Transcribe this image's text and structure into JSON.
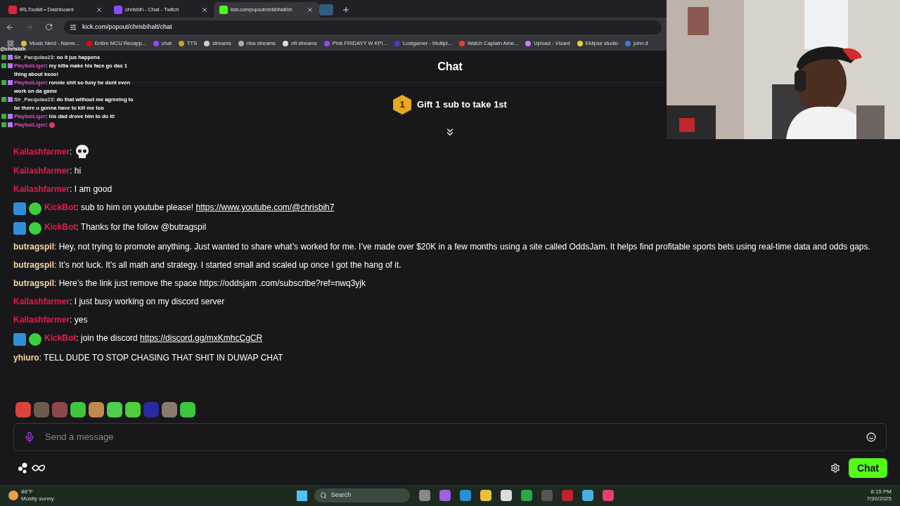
{
  "tabs": [
    {
      "title": "IRLToolkit • Dashboard",
      "selected": false,
      "color": "#e0243a"
    },
    {
      "title": "chrisbih - Chat - Twitch",
      "selected": false,
      "color": "#9147ff"
    },
    {
      "title": "kick.com/popout/chrisbihalt/ch",
      "selected": true,
      "color": "#53fc18"
    }
  ],
  "address": "kick.com/popout/chrisbihalt/chat",
  "bookmarks": [
    {
      "label": "Music Nerd - Name...",
      "color": "#e8b93a"
    },
    {
      "label": "Entire MCU Recapp...",
      "color": "#ff0000"
    },
    {
      "label": "chat",
      "color": "#9147ff"
    },
    {
      "label": "TTS",
      "color": "#c9a227"
    },
    {
      "label": "streams",
      "color": "#cccccc"
    },
    {
      "label": "nba streams",
      "color": "#aaaaaa"
    },
    {
      "label": "nfl streams",
      "color": "#dddddd"
    },
    {
      "label": "Pink FRIDAYY W KP!...",
      "color": "#9147ff"
    },
    {
      "label": "Lostgamer - Multipl...",
      "color": "#4b3ccf"
    },
    {
      "label": "Watch Captain Ame...",
      "color": "#e8402a"
    },
    {
      "label": "Upload - Vizard",
      "color": "#c77dff"
    },
    {
      "label": "Eklipse studio",
      "color": "#e8d23a"
    },
    {
      "label": "john d",
      "color": "#3a7bd5"
    }
  ],
  "overlay": {
    "channel": "@chrisbih",
    "lines": [
      {
        "name": "Sir_Pacquiao23",
        "color": "#cfcfcf",
        "text": ": no it jus happens",
        "kind": "text"
      },
      {
        "name": "PlayboiLiger",
        "color": "#e04cc4",
        "text": ": my killa make his face go das 1 thing about ksoo!",
        "kind": "text"
      },
      {
        "name": "PlayboiLiger",
        "color": "#e04cc4",
        "text": ": ronnie shit so funy he dont even work on da game",
        "kind": "text"
      },
      {
        "name": "Sir_Pacquiao23",
        "color": "#cfcfcf",
        "text": ": do that without me agreeing to be there u gonna have to kill me too",
        "kind": "text"
      },
      {
        "name": "PlayboiLiger",
        "color": "#e04cc4",
        "text": ": his dad drove him to do it!",
        "kind": "text"
      },
      {
        "name": "PlayboiLiger",
        "color": "#e04cc4",
        "text": ":",
        "kind": "emote"
      }
    ]
  },
  "chat": {
    "title": "Chat",
    "gift_rank": "1",
    "gift_text": "Gift 1 sub to take 1st",
    "messages": [
      {
        "kind": "emote",
        "name": "Kailashfarmer",
        "color": "#e01e4c",
        "text": ":"
      },
      {
        "kind": "user",
        "name": "Kailashfarmer",
        "color": "#e01e4c",
        "text": ": hi"
      },
      {
        "kind": "user",
        "name": "Kailashfarmer",
        "color": "#e01e4c",
        "text": ": I am good"
      },
      {
        "kind": "bot",
        "name": "KickBot",
        "color": "#e01e4c",
        "text": ": sub to him on youtube please!",
        "link": "https://www.youtube.com/@chrisbih7"
      },
      {
        "kind": "bot",
        "name": "KickBot",
        "color": "#e01e4c",
        "text": ": Thanks for the follow @butragspil"
      },
      {
        "kind": "user",
        "name": "butragspil",
        "color": "#f5d7a0",
        "text": ": Hey, not trying to promote anything. Just wanted to share what’s worked for me. I’ve made over $20K in a few months using a site called OddsJam. It helps find profitable sports bets using real-time data and odds gaps."
      },
      {
        "kind": "user",
        "name": "butragspil",
        "color": "#f5d7a0",
        "text": ": It’s not luck. It’s all math and strategy. I started small and scaled up once I got the hang of it."
      },
      {
        "kind": "user",
        "name": "butragspil",
        "color": "#f5d7a0",
        "text": ": Here’s the link just remove the space https://oddsjam .com/subscribe?ref=nwq3yjk"
      },
      {
        "kind": "user",
        "name": "Kailashfarmer",
        "color": "#e01e4c",
        "text": ": I just busy working on my discord server"
      },
      {
        "kind": "user",
        "name": "Kailashfarmer",
        "color": "#e01e4c",
        "text": ": yes"
      },
      {
        "kind": "bot",
        "name": "KickBot",
        "color": "#e01e4c",
        "text": ": join the discord",
        "link": "https://discord.gg/mxKmhcCgCR"
      },
      {
        "kind": "user",
        "name": "yhiuro",
        "color": "#f5d7a0",
        "text": ": TELL DUDE TO STOP CHASING THAT SHIT IN DUWAP CHAT"
      }
    ],
    "emotes": [
      {
        "color": "#d9453a"
      },
      {
        "color": "#6b5a4e"
      },
      {
        "color": "#8a4a4a"
      },
      {
        "color": "#3cc83c"
      },
      {
        "color": "#c08a4a"
      },
      {
        "color": "#4ccf4c"
      },
      {
        "color": "#4ccf3a"
      },
      {
        "color": "#2a2aa0"
      },
      {
        "color": "#8a7a70"
      },
      {
        "color": "#3cc83c"
      }
    ],
    "input_placeholder": "Send a message",
    "send_label": "Chat"
  },
  "taskbar": {
    "temperature": "86°F",
    "weather": "Mostly sunny",
    "search": "Search",
    "time": "8:15 PM",
    "date": "7/30/2025"
  }
}
